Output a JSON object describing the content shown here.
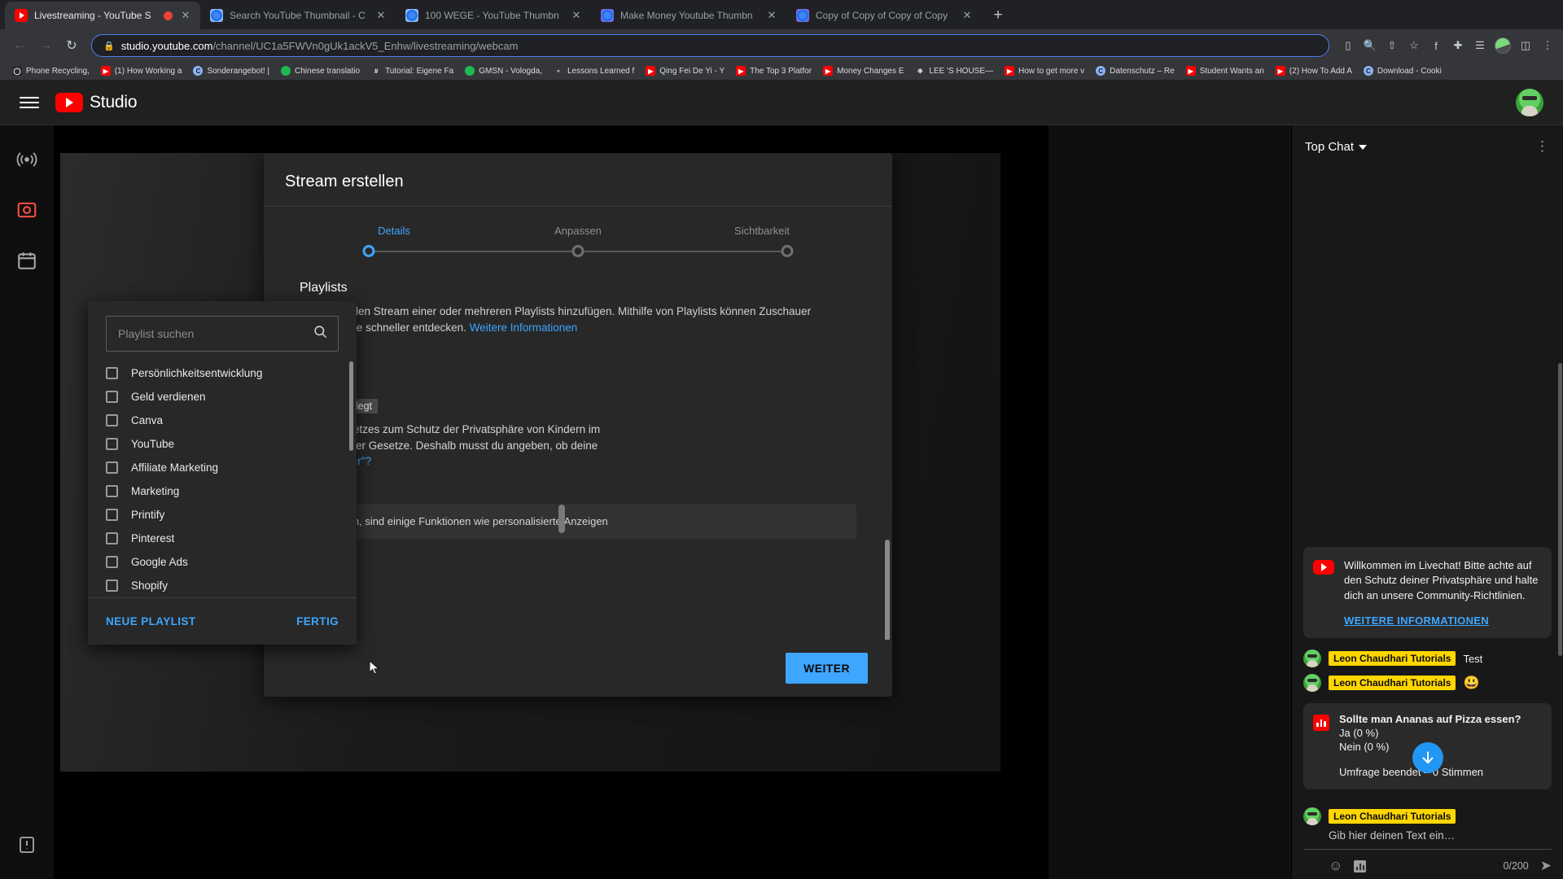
{
  "browser": {
    "tabs": [
      {
        "title": "Livestreaming - YouTube S",
        "favicon": "youtube-icon",
        "active": true,
        "recording": true
      },
      {
        "title": "Search YouTube Thumbnail - C",
        "favicon": "chrome-icon",
        "active": false
      },
      {
        "title": "100 WEGE - YouTube Thumbn",
        "favicon": "chrome-icon",
        "active": false
      },
      {
        "title": "Make Money Youtube Thumbn",
        "favicon": "chrome-alt-icon",
        "active": false
      },
      {
        "title": "Copy of Copy of Copy of Copy",
        "favicon": "chrome-alt-icon",
        "active": false
      }
    ],
    "new_tab_label": "+",
    "nav": {
      "back": "←",
      "forward": "→",
      "reload": "↻"
    },
    "address": {
      "lock_icon": "lock-icon",
      "host": "studio.youtube.com",
      "path": "/channel/UC1a5FWVn0gUk1ackV5_Enhw/livestreaming/webcam"
    },
    "toolbar_icons": [
      "cast-icon",
      "zoom-icon",
      "share-icon",
      "bookmark-star-icon",
      "facebook-icon",
      "extension-icon",
      "sidepanel-icon",
      "profile-icon",
      "menu-icon"
    ],
    "bookmarks": [
      {
        "label": "Phone Recycling,",
        "color": "#ffffff",
        "glyph": "○"
      },
      {
        "label": "(1) How Working a",
        "color": "#ff0000",
        "glyph": "▶"
      },
      {
        "label": "Sonderangebot! |",
        "color": "#8ab4f8",
        "glyph": "C"
      },
      {
        "label": "Chinese translatio",
        "color": "#1db954",
        "glyph": "●"
      },
      {
        "label": "Tutorial: Eigene Fa",
        "color": "#ffffff",
        "glyph": "#"
      },
      {
        "label": "GMSN - Vologda,",
        "color": "#1db954",
        "glyph": "●"
      },
      {
        "label": "Lessons Learned f",
        "color": "#c0c0c0",
        "glyph": "o▪"
      },
      {
        "label": "Qing Fei De Yi - Y",
        "color": "#ff0000",
        "glyph": "▶"
      },
      {
        "label": "The Top 3 Platfor",
        "color": "#ff0000",
        "glyph": "▶"
      },
      {
        "label": "Money Changes E",
        "color": "#ff0000",
        "glyph": "▶"
      },
      {
        "label": "LEE 'S HOUSE—",
        "color": "#c0c0c0",
        "glyph": "❉"
      },
      {
        "label": "How to get more v",
        "color": "#ff0000",
        "glyph": "▶"
      },
      {
        "label": "Datenschutz – Re",
        "color": "#8ab4f8",
        "glyph": "C"
      },
      {
        "label": "Student Wants an",
        "color": "#ff0000",
        "glyph": "▶"
      },
      {
        "label": "(2) How To Add A",
        "color": "#ff0000",
        "glyph": "▶"
      },
      {
        "label": "Download - Cooki",
        "color": "#8ab4f8",
        "glyph": "C"
      }
    ]
  },
  "studio": {
    "brand": "Studio",
    "menu_icon": "hamburger-icon",
    "rail": [
      {
        "name": "go-live-icon",
        "glyph": "((•))"
      },
      {
        "name": "webcam-icon",
        "glyph": "▣"
      },
      {
        "name": "schedule-icon",
        "glyph": "▦"
      },
      {
        "name": "feedback-icon",
        "glyph": "❗"
      }
    ]
  },
  "modal": {
    "title": "Stream erstellen",
    "steps": [
      {
        "label": "Details",
        "active": true
      },
      {
        "label": "Anpassen",
        "active": false
      },
      {
        "label": "Sichtbarkeit",
        "active": false
      }
    ],
    "section_title": "Playlists",
    "section_desc_1": "Du kannst den Stream einer oder mehreren Playlists hinzufügen. Mithilfe von Playlists können Zuschauer deine Inhalte",
    "section_desc_2": "schneller entdecken.",
    "section_link": "Weitere Informationen",
    "background": {
      "chip": "n dir festgelegt",
      "para_line_1": "es US-Gesetzes zum Schutz der Privatsphäre von Kindern im",
      "para_line_2": "/oder anderer Gesetze. Deshalb musst du angeben, ob deine",
      "para_link": "ell für Kinder\"?",
      "note": "et wurden, sind einige Funktionen wie personalisierte Anzeigen"
    },
    "next_button": "WEITER"
  },
  "playlist_dropdown": {
    "search_placeholder": "Playlist suchen",
    "search_value": "",
    "search_icon": "search-icon",
    "items": [
      {
        "label": "Persönlichkeitsentwicklung",
        "checked": false
      },
      {
        "label": "Geld verdienen",
        "checked": false
      },
      {
        "label": "Canva",
        "checked": false
      },
      {
        "label": "YouTube",
        "checked": false
      },
      {
        "label": "Affiliate Marketing",
        "checked": false
      },
      {
        "label": "Marketing",
        "checked": false
      },
      {
        "label": "Printify",
        "checked": false
      },
      {
        "label": "Pinterest",
        "checked": false
      },
      {
        "label": "Google Ads",
        "checked": false
      },
      {
        "label": "Shopify",
        "checked": false
      }
    ],
    "new_playlist_button": "NEUE PLAYLIST",
    "done_button": "FERTIG"
  },
  "chat": {
    "title": "Top Chat",
    "caret_icon": "chevron-down-icon",
    "kebab_icon": "more-vertical-icon",
    "system_message": {
      "icon": "youtube-icon",
      "text": "Willkommen im Livechat! Bitte achte auf den Schutz deiner Privatsphäre und halte dich an unsere Community-Richtlinien.",
      "link": "WEITERE INFORMATIONEN"
    },
    "messages": [
      {
        "author": "Leon Chaudhari Tutorials",
        "text": "Test"
      },
      {
        "author": "Leon Chaudhari Tutorials",
        "text": "😃"
      }
    ],
    "poll": {
      "icon": "poll-icon",
      "question": "Sollte man Ananas auf Pizza essen?",
      "options": [
        "Ja (0 %)",
        "Nein (0 %)"
      ],
      "status": "Umfrage beendet – 0 Stimmen"
    },
    "scroll_to_bottom_icon": "arrow-down-icon",
    "input": {
      "author": "Leon Chaudhari Tutorials",
      "placeholder": "Gib hier deinen Text ein…",
      "value": "",
      "emoji_icon": "emoji-icon",
      "poll_icon": "create-poll-icon",
      "counter": "0/200",
      "send_icon": "send-icon"
    },
    "messages_after_poll": [
      {
        "author": "Leon Chaudhari Tutorials"
      }
    ]
  }
}
